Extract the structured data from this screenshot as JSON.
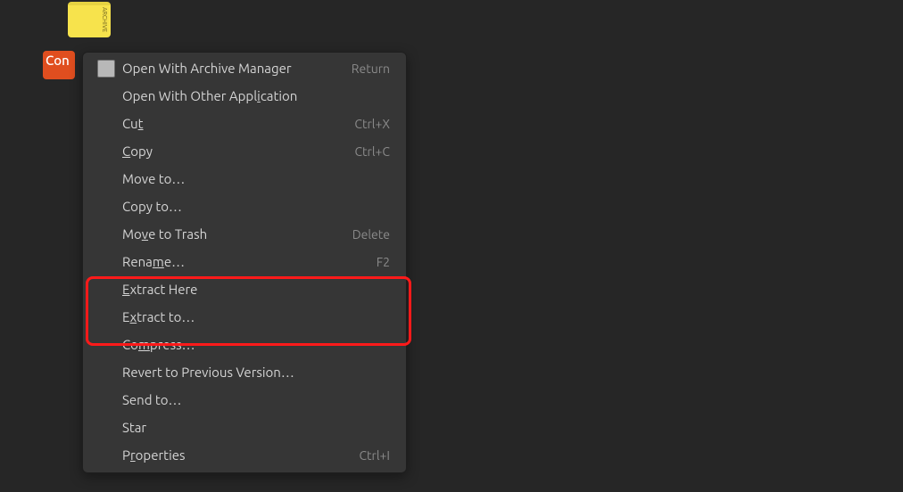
{
  "desktop": {
    "archive_icon_label": "ARCHIVE",
    "app_icon_label": "Con"
  },
  "menu": {
    "open_archive": {
      "label_html": "Open With Archive Manager",
      "accel": "Return",
      "icon": true,
      "underline_idx": null
    },
    "open_other": {
      "label_html": "Open With Other Application",
      "accel": "",
      "underline_idx": 20
    },
    "cut": {
      "label_html": "Cut",
      "accel": "Ctrl+X",
      "underline_idx": 2
    },
    "copy": {
      "label_html": "Copy",
      "accel": "Ctrl+C",
      "underline_idx": 0
    },
    "move_to": {
      "label_html": "Move to…",
      "accel": "",
      "underline_idx": null
    },
    "copy_to": {
      "label_html": "Copy to…",
      "accel": "",
      "underline_idx": null
    },
    "move_trash": {
      "label_html": "Move to Trash",
      "accel": "Delete",
      "underline_idx": 2
    },
    "rename": {
      "label_html": "Rename…",
      "accel": "F2",
      "underline_idx": 4
    },
    "extract_here": {
      "label_html": "Extract Here",
      "accel": "",
      "underline_idx": 0
    },
    "extract_to": {
      "label_html": "Extract to…",
      "accel": "",
      "underline_idx": 1
    },
    "compress": {
      "label_html": "Compress…",
      "accel": "",
      "underline_idx": 2
    },
    "revert": {
      "label_html": "Revert to Previous Version…",
      "accel": "",
      "underline_idx": null
    },
    "send_to": {
      "label_html": "Send to…",
      "accel": "",
      "underline_idx": null
    },
    "star": {
      "label_html": "Star",
      "accel": "",
      "underline_idx": null
    },
    "properties": {
      "label_html": "Properties",
      "accel": "Ctrl+I",
      "underline_idx": 1
    }
  },
  "highlight": {
    "desc": "Extract Here / Extract to…"
  }
}
